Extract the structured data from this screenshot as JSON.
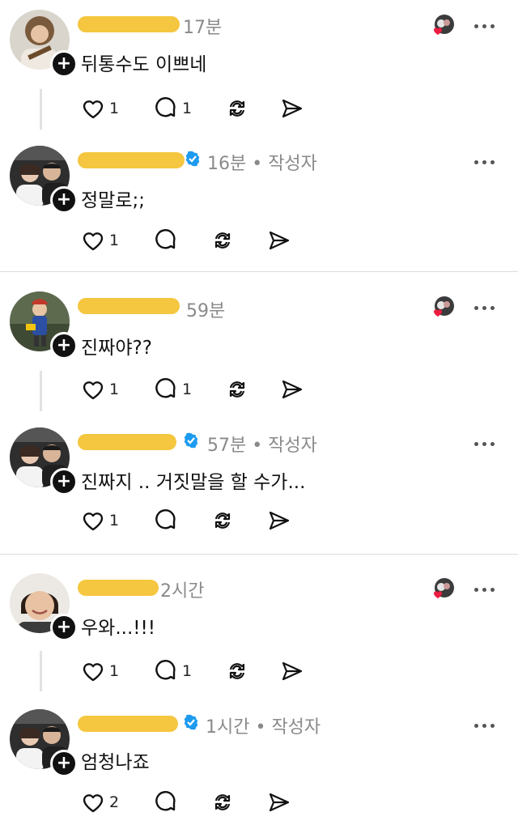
{
  "threads": [
    {
      "comment": {
        "time": "17분",
        "text": "뒤통수도 이쁘네",
        "likes": "1",
        "replies": "1",
        "avatar": "curly-hair-guitar-avatar",
        "liked_by_author": true
      },
      "reply": {
        "time": "16분 • 작성자",
        "text": "정말로;;",
        "likes": "1",
        "replies": "",
        "avatar": "couple-photo-avatar",
        "verified": true
      }
    },
    {
      "comment": {
        "time": "59분",
        "text": "진짜야??",
        "likes": "1",
        "replies": "1",
        "avatar": "child-costume-avatar",
        "liked_by_author": true
      },
      "reply": {
        "time": "57분 • 작성자",
        "text": "진짜지 .. 거짓말을 할 수가...",
        "likes": "1",
        "replies": "",
        "avatar": "couple-photo-avatar",
        "verified": true
      }
    },
    {
      "comment": {
        "time": "2시간",
        "text": "우와...!!!",
        "likes": "1",
        "replies": "1",
        "avatar": "smiling-woman-avatar",
        "liked_by_author": true
      },
      "reply": {
        "time": "1시간 • 작성자",
        "text": "엄청나죠",
        "likes": "2",
        "replies": "",
        "avatar": "couple-photo-avatar",
        "verified": true
      }
    }
  ],
  "colors": {
    "redaction": "#f5c63f",
    "verified": "#1d9bf0",
    "heart": "#ed1c40",
    "meta": "#8a8a8a"
  }
}
